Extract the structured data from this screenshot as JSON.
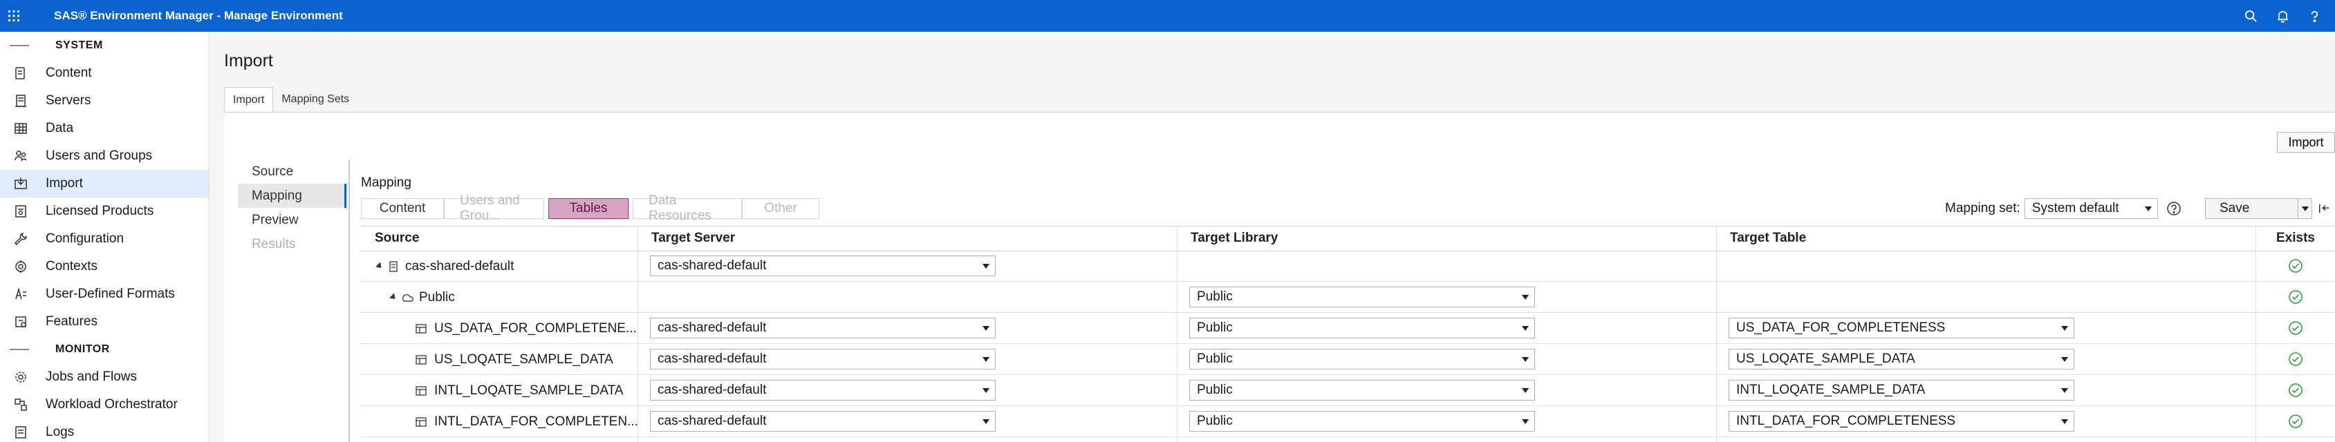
{
  "app": {
    "title": "SAS® Environment Manager - Manage Environment",
    "top_icons": [
      "search-icon",
      "bell-icon",
      "help-icon"
    ]
  },
  "nav": {
    "sections": [
      {
        "label": "SYSTEM",
        "items": [
          {
            "label": "Content",
            "icon": "content-icon"
          },
          {
            "label": "Servers",
            "icon": "server-icon"
          },
          {
            "label": "Data",
            "icon": "table-icon"
          },
          {
            "label": "Users and Groups",
            "icon": "users-icon"
          },
          {
            "label": "Import",
            "icon": "import-icon",
            "active": true
          },
          {
            "label": "Licensed Products",
            "icon": "license-icon"
          },
          {
            "label": "Configuration",
            "icon": "wrench-icon"
          },
          {
            "label": "Contexts",
            "icon": "contexts-icon"
          },
          {
            "label": "User-Defined Formats",
            "icon": "formats-icon"
          },
          {
            "label": "Features",
            "icon": "features-icon"
          }
        ]
      },
      {
        "label": "MONITOR",
        "items": [
          {
            "label": "Jobs and Flows",
            "icon": "gear-icon"
          },
          {
            "label": "Workload Orchestrator",
            "icon": "workload-icon"
          },
          {
            "label": "Logs",
            "icon": "logs-icon"
          }
        ]
      }
    ]
  },
  "page": {
    "title": "Import",
    "tabs": [
      {
        "label": "Import",
        "active": true
      },
      {
        "label": "Mapping Sets",
        "active": false
      }
    ],
    "import_button": "Import",
    "steps": [
      {
        "label": "Source",
        "state": "normal"
      },
      {
        "label": "Mapping",
        "state": "active"
      },
      {
        "label": "Preview",
        "state": "normal"
      },
      {
        "label": "Results",
        "state": "disabled"
      }
    ],
    "mapping_title": "Mapping",
    "segments": [
      {
        "label": "Content",
        "state": "normal"
      },
      {
        "label": "Users and Grou...",
        "state": "disabled"
      },
      {
        "label": "Tables",
        "state": "selected"
      },
      {
        "label": "Data Resources",
        "state": "disabled"
      },
      {
        "label": "Other",
        "state": "disabled"
      }
    ],
    "mapping_set_label": "Mapping set:",
    "mapping_set_value": "System default",
    "save_label": "Save"
  },
  "table": {
    "columns": [
      "Source",
      "Target Server",
      "Target Library",
      "Target Table",
      "Exists"
    ],
    "rows": [
      {
        "source": "cas-shared-default",
        "level": 0,
        "icon": "server-icon",
        "server": "cas-shared-default",
        "library": "",
        "table": "",
        "exists": true
      },
      {
        "source": "Public",
        "level": 1,
        "icon": "library-icon",
        "server": "",
        "library": "Public",
        "table": "",
        "exists": true
      },
      {
        "source": "US_DATA_FOR_COMPLETENE...",
        "level": 2,
        "icon": "table-icon",
        "server": "cas-shared-default",
        "library": "Public",
        "table": "US_DATA_FOR_COMPLETENESS",
        "exists": true
      },
      {
        "source": "US_LOQATE_SAMPLE_DATA",
        "level": 2,
        "icon": "table-icon",
        "server": "cas-shared-default",
        "library": "Public",
        "table": "US_LOQATE_SAMPLE_DATA",
        "exists": true
      },
      {
        "source": "INTL_LOQATE_SAMPLE_DATA",
        "level": 2,
        "icon": "table-icon",
        "server": "cas-shared-default",
        "library": "Public",
        "table": "INTL_LOQATE_SAMPLE_DATA",
        "exists": true
      },
      {
        "source": "INTL_DATA_FOR_COMPLETEN...",
        "level": 2,
        "icon": "table-icon",
        "server": "cas-shared-default",
        "library": "Public",
        "table": "INTL_DATA_FOR_COMPLETENESS",
        "exists": true
      }
    ]
  },
  "colors": {
    "header_bg": "#0b63d1",
    "active_nav_bg": "#e0ecfb",
    "tables_segment_bg": "#d8a6c4",
    "exists_check": "#2e9e3f"
  }
}
